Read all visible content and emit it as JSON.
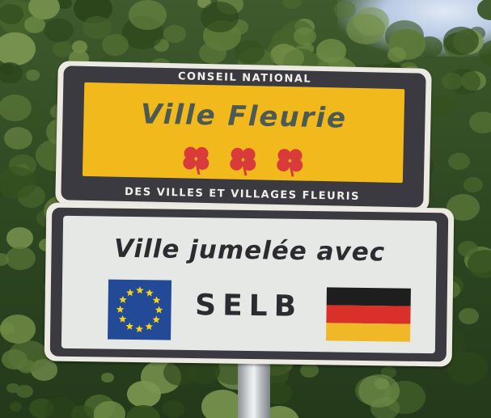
{
  "sign_top": {
    "header": "CONSEIL NATIONAL",
    "title": "Ville Fleurie",
    "footer": "DES VILLES ET VILLAGES FLEURIS",
    "flower_count": 3,
    "colors": {
      "panel": "#f2b91c",
      "flower": "#d93b3b",
      "text": "#4b5a54"
    }
  },
  "sign_bottom": {
    "line1": "Ville jumelée avec",
    "city": "SELB",
    "left_emblem": "eu-flag-icon",
    "right_emblem": "germany-flag-icon",
    "colors": {
      "eu_blue": "#234a96",
      "eu_star": "#f4d21f",
      "de_black": "#1e1e1e",
      "de_red": "#d9302a",
      "de_gold": "#f0b726"
    }
  }
}
